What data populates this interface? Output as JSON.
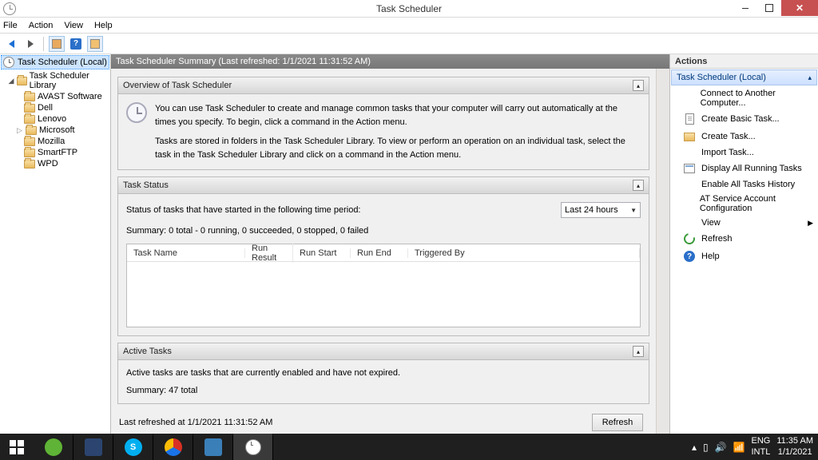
{
  "window": {
    "title": "Task Scheduler"
  },
  "menu": {
    "file": "File",
    "action": "Action",
    "view": "View",
    "help": "Help"
  },
  "tree": {
    "root": "Task Scheduler (Local)",
    "library": "Task Scheduler Library",
    "items": [
      "AVAST Software",
      "Dell",
      "Lenovo",
      "Microsoft",
      "Mozilla",
      "SmartFTP",
      "WPD"
    ]
  },
  "summary": {
    "header": "Task Scheduler Summary (Last refreshed: 1/1/2021 11:31:52 AM)",
    "overview_title": "Overview of Task Scheduler",
    "overview_p1": "You can use Task Scheduler to create and manage common tasks that your computer will carry out automatically at the times you specify. To begin, click a command in the Action menu.",
    "overview_p2": "Tasks are stored in folders in the Task Scheduler Library. To view or perform an operation on an individual task, select the task in the Task Scheduler Library and click on a command in the Action menu.",
    "status_title": "Task Status",
    "status_period_label": "Status of tasks that have started in the following time period:",
    "period_value": "Last 24 hours",
    "status_summary": "Summary: 0 total - 0 running, 0 succeeded, 0 stopped, 0 failed",
    "cols": {
      "name": "Task Name",
      "result": "Run Result",
      "start": "Run Start",
      "end": "Run End",
      "trig": "Triggered By"
    },
    "active_title": "Active Tasks",
    "active_desc": "Active tasks are tasks that are currently enabled and have not expired.",
    "active_summary": "Summary: 47 total",
    "last_refreshed": "Last refreshed at 1/1/2021 11:31:52 AM",
    "refresh_btn": "Refresh"
  },
  "actions": {
    "title": "Actions",
    "subtitle": "Task Scheduler (Local)",
    "items": [
      "Connect to Another Computer...",
      "Create Basic Task...",
      "Create Task...",
      "Import Task...",
      "Display All Running Tasks",
      "Enable All Tasks History",
      "AT Service Account Configuration",
      "View",
      "Refresh",
      "Help"
    ]
  },
  "taskbar": {
    "lang1": "ENG",
    "lang2": "INTL",
    "time": "11:35 AM",
    "date": "1/1/2021"
  }
}
